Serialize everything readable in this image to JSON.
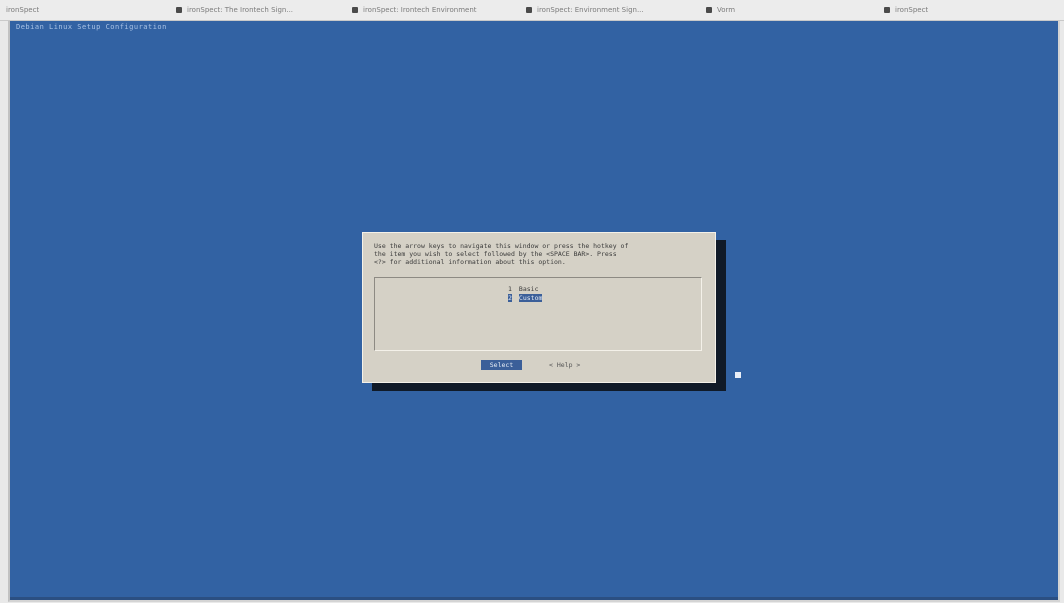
{
  "tabs": [
    {
      "label": "ironSpect"
    },
    {
      "label": "ironSpect: The Irontech Sign..."
    },
    {
      "label": "ironSpect: Irontech Environment"
    },
    {
      "label": "ironSpect: Environment Sign..."
    },
    {
      "label": "Vorm"
    },
    {
      "label": "ironSpect"
    }
  ],
  "terminal": {
    "backtitle": "Debian Linux Setup Configuration"
  },
  "dialog": {
    "text_line1": "Use the arrow keys to navigate this window or press the hotkey of",
    "text_line2": "the item you wish to select followed by the <SPACE BAR>. Press",
    "text_line3": "<?> for additional information about this option.",
    "items": [
      {
        "tag": "1",
        "label": "Basic"
      },
      {
        "tag": "2",
        "label": "Custom"
      }
    ],
    "select_label": "Select",
    "help_label": "< Help >"
  },
  "colors": {
    "background": "#3262a3",
    "dialog": "#d5d1c6",
    "highlight": "#3b5f99"
  }
}
